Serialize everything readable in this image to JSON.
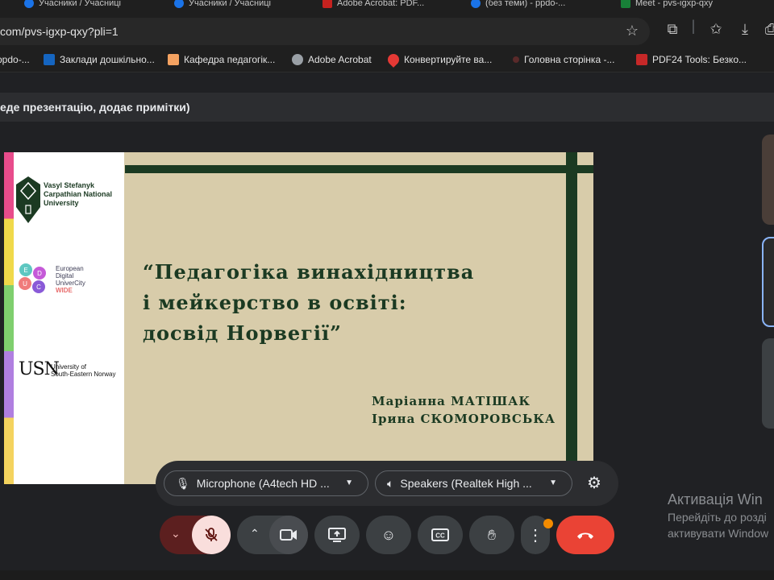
{
  "browser": {
    "tabs": [
      {
        "label": "Учасники / Учасниці"
      },
      {
        "label": "Учасники / Учасниці"
      },
      {
        "label": "Adobe Acrobat: PDF..."
      },
      {
        "label": "(без теми) - ppdo-..."
      },
      {
        "label": "Meet - pvs-igxp-qxy"
      }
    ],
    "url": "com/pvs-igxp-qxy?pli=1",
    "bookmarks": [
      {
        "label": "ppdo-...",
        "color": "#4285f4"
      },
      {
        "label": "Заклади дошкільно...",
        "color": "#1565c0"
      },
      {
        "label": "Кафедра педагогік...",
        "color": "#f4a261"
      },
      {
        "label": "Adobe Acrobat",
        "color": "#9aa0a6"
      },
      {
        "label": "Конвертируйте ва...",
        "color": "#e53935"
      },
      {
        "label": "Головна сторінка -...",
        "color": "#5a2a2a"
      },
      {
        "label": "PDF24 Tools: Безко...",
        "color": "#c62828"
      }
    ]
  },
  "meet": {
    "presenter_banner": "еде презентацію, додає примітки)",
    "slide": {
      "university_name": "Vasyl Stefanyk\nCarpathian National\nUniversity",
      "eu_logo_letters": [
        "E",
        "D",
        "U",
        "C"
      ],
      "eu_text_lines": [
        "European",
        "Digital",
        "UniverCity"
      ],
      "eu_wide": "WIDE",
      "usn_mark": "USN",
      "usn_text": "University of\nSouth-Eastern Norway",
      "title": "“Педагогіка винахідництва\nі мейкерство в освіті:\nдосвід Норвегії”",
      "authors": [
        "Маріанна МАТІШАК",
        "Ірина СКОМОРОВСЬКА"
      ],
      "strip_colors": [
        "#e84c8b",
        "#f0d94a",
        "#7fcf6e",
        "#b07fe0",
        "#f4d35e"
      ]
    },
    "devices": {
      "microphone": "Microphone (A4tech HD ...",
      "speakers": "Speakers (Realtek High ..."
    },
    "controls": {
      "mic_state": "muted",
      "more_dot_color": "#f28b00",
      "hangup_color": "#ea4335"
    }
  },
  "windows_activation": {
    "title": "Активація Win",
    "line1": "Перейдіть до розді",
    "line2": "активувати Window"
  }
}
